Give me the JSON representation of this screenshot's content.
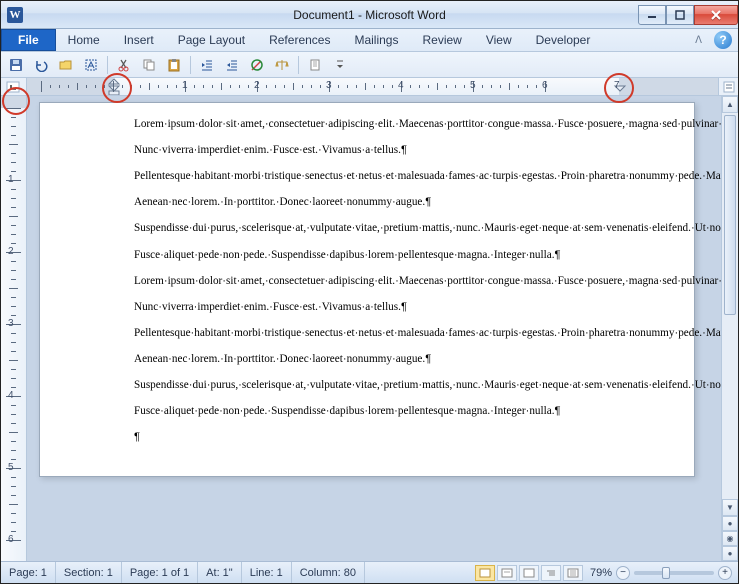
{
  "window": {
    "title": "Document1  -  Microsoft Word",
    "app_letter": "W"
  },
  "menu": {
    "file": "File",
    "tabs": [
      "Home",
      "Insert",
      "Page Layout",
      "References",
      "Mailings",
      "Review",
      "View",
      "Developer"
    ]
  },
  "ruler": {
    "numbers": [
      "1",
      "2",
      "3",
      "4",
      "5",
      "6",
      "7"
    ]
  },
  "document": {
    "paragraphs": [
      "Lorem ipsum dolor sit amet, consectetuer adipiscing elit. Maecenas porttitor congue massa. Fusce posuere, magna sed pulvinar ultricies, purus lectus malesuada libero, sit amet commodo magna eros quis urna.",
      "Nunc viverra imperdiet enim. Fusce est. Vivamus a tellus.",
      "Pellentesque habitant morbi tristique senectus et netus et malesuada fames ac turpis egestas. Proin pharetra nonummy pede. Mauris et orci.",
      "Aenean nec lorem. In porttitor. Donec laoreet nonummy augue.",
      "Suspendisse dui purus, scelerisque at, vulputate vitae, pretium mattis, nunc. Mauris eget neque at sem venenatis eleifend. Ut nonummy.",
      "Fusce aliquet pede non pede. Suspendisse dapibus lorem pellentesque magna. Integer nulla.",
      "Lorem ipsum dolor sit amet, consectetuer adipiscing elit. Maecenas porttitor congue massa. Fusce posuere, magna sed pulvinar ultricies, purus lectus malesuada libero, sit amet commodo magna eros quis urna.",
      "Nunc viverra imperdiet enim. Fusce est. Vivamus a tellus.",
      "Pellentesque habitant morbi tristique senectus et netus et malesuada fames ac turpis egestas. Proin pharetra nonummy pede. Mauris et orci.",
      "Aenean nec lorem. In porttitor. Donec laoreet nonummy augue.",
      "Suspendisse dui purus, scelerisque at, vulputate vitae, pretium mattis, nunc. Mauris eget neque at sem venenatis eleifend. Ut nonummy.",
      "Fusce aliquet pede non pede. Suspendisse dapibus lorem pellentesque magna. Integer nulla."
    ],
    "pilcrow": "¶",
    "middot": "·"
  },
  "status": {
    "page": "Page: 1",
    "section": "Section: 1",
    "page_of": "Page: 1 of 1",
    "at": "At:  1\"",
    "line": "Line: 1",
    "column": "Column: 80",
    "zoom": "79%"
  },
  "icons": {
    "minimize": "minimize",
    "maximize": "maximize",
    "close": "close",
    "help": "?"
  }
}
